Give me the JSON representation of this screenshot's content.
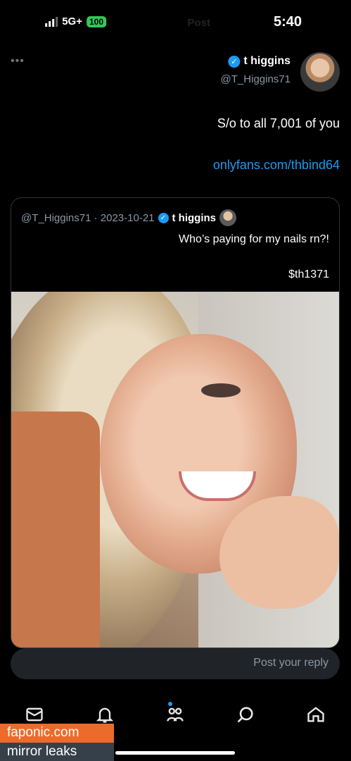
{
  "status_bar": {
    "time": "5:40",
    "network": "5G+",
    "battery": "100"
  },
  "header": {
    "ghost_title": "Post"
  },
  "post": {
    "display_name": "t higgins",
    "handle": "@T_Higgins71",
    "text": "S/o to all 7,001 of you",
    "link": "onlyfans.com/thbind64"
  },
  "quote": {
    "display_name": "t higgins",
    "meta": "@T_Higgins71 · 2023-10-21",
    "text": "Who’s paying for my nails rn?!",
    "text2": "$th1371"
  },
  "reply": {
    "placeholder": "Post your reply"
  },
  "tabs": [
    {
      "name": "home",
      "icon": "home-icon"
    },
    {
      "name": "search",
      "icon": "search-icon"
    },
    {
      "name": "communities",
      "icon": "communities-icon",
      "has_dot": true
    },
    {
      "name": "notifications",
      "icon": "bell-icon"
    },
    {
      "name": "messages",
      "icon": "mail-icon"
    }
  ],
  "watermark": {
    "line1": "faponic.com",
    "line2": "mirror leaks"
  },
  "colors": {
    "accent": "#1d9bf0",
    "battery": "#34c759",
    "watermark_orange": "#ec6b2b",
    "watermark_dark": "#36404a"
  }
}
